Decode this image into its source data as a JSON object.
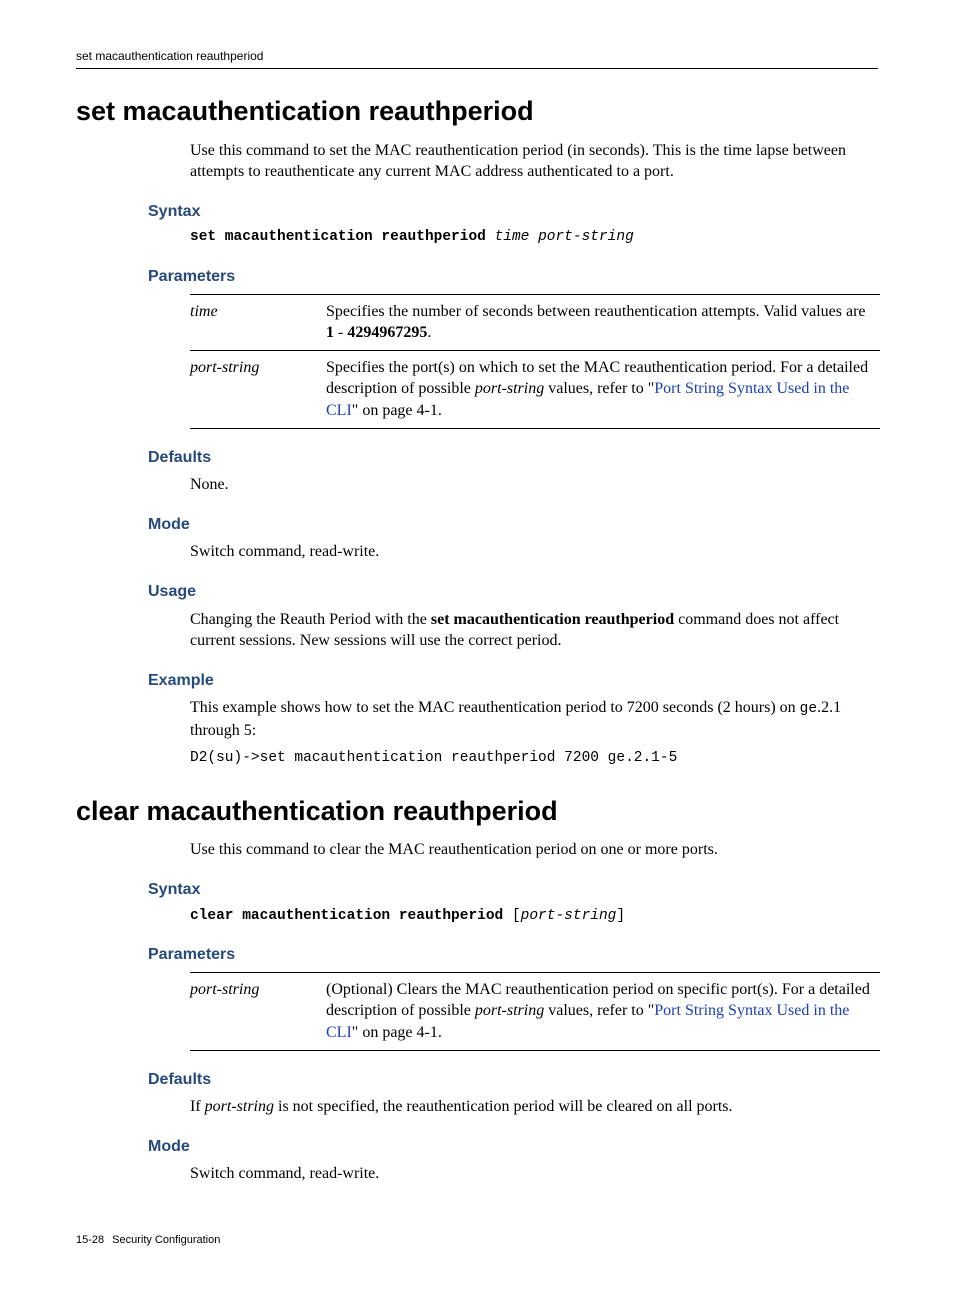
{
  "header": {
    "running_title": "set macauthentication reauthperiod"
  },
  "cmd1": {
    "title": "set macauthentication reauthperiod",
    "intro": "Use this command to set the MAC reauthentication period (in seconds). This is the time lapse between attempts to reauthenticate any current MAC address authenticated to a port.",
    "syntax_heading": "Syntax",
    "syntax_bold": "set macauthentication reauthperiod ",
    "syntax_ital": "time port-string",
    "params_heading": "Parameters",
    "param_time_name": "time",
    "param_time_desc_a": "Specifies the number of seconds between reauthentication attempts. Valid values are ",
    "param_time_bold_a": "1",
    "param_time_mid": " - ",
    "param_time_bold_b": "4294967295",
    "param_time_desc_b": ".",
    "param_ps_name": "port-string",
    "param_ps_desc_a": "Specifies the port(s) on which to set the MAC reauthentication period. For a detailed description of possible ",
    "param_ps_ital": "port-string",
    "param_ps_desc_b": " values, refer to \"",
    "param_ps_link": "Port String Syntax Used in the CLI",
    "param_ps_desc_c": "\" on page 4-1.",
    "defaults_heading": "Defaults",
    "defaults_body": "None.",
    "mode_heading": "Mode",
    "mode_body": "Switch command, read-write.",
    "usage_heading": "Usage",
    "usage_a": "Changing the Reauth Period with the ",
    "usage_bold": "set macauthentication reauthperiod",
    "usage_b": " command does not affect current sessions. New sessions will use the correct period.",
    "example_heading": "Example",
    "example_intro_a": "This example shows how to set the MAC reauthentication period to 7200 seconds (2 hours) on ",
    "example_intro_mono": "ge",
    "example_intro_b": ".2.1 through 5:",
    "example_code": "D2(su)->set macauthentication reauthperiod 7200 ge.2.1-5"
  },
  "cmd2": {
    "title": "clear macauthentication reauthperiod",
    "intro": "Use this command to clear the MAC reauthentication period on one or more ports.",
    "syntax_heading": "Syntax",
    "syntax_bold": "clear macauthentication reauthperiod ",
    "syntax_plain_a": "[",
    "syntax_ital": "port-string",
    "syntax_plain_b": "]",
    "params_heading": "Parameters",
    "param_ps_name": "port-string",
    "param_ps_desc_a": "(Optional) Clears the MAC reauthentication period on specific port(s). For a detailed description of possible ",
    "param_ps_ital": "port-string",
    "param_ps_desc_b": " values, refer to \"",
    "param_ps_link": "Port String Syntax Used in the CLI",
    "param_ps_desc_c": "\" on page 4-1.",
    "defaults_heading": "Defaults",
    "defaults_body_a": "If ",
    "defaults_body_ital": "port-string",
    "defaults_body_b": " is not specified, the reauthentication period will be cleared on all ports.",
    "mode_heading": "Mode",
    "mode_body": "Switch command, read-write."
  },
  "footer": {
    "page": "15-28",
    "section": "Security Configuration"
  }
}
